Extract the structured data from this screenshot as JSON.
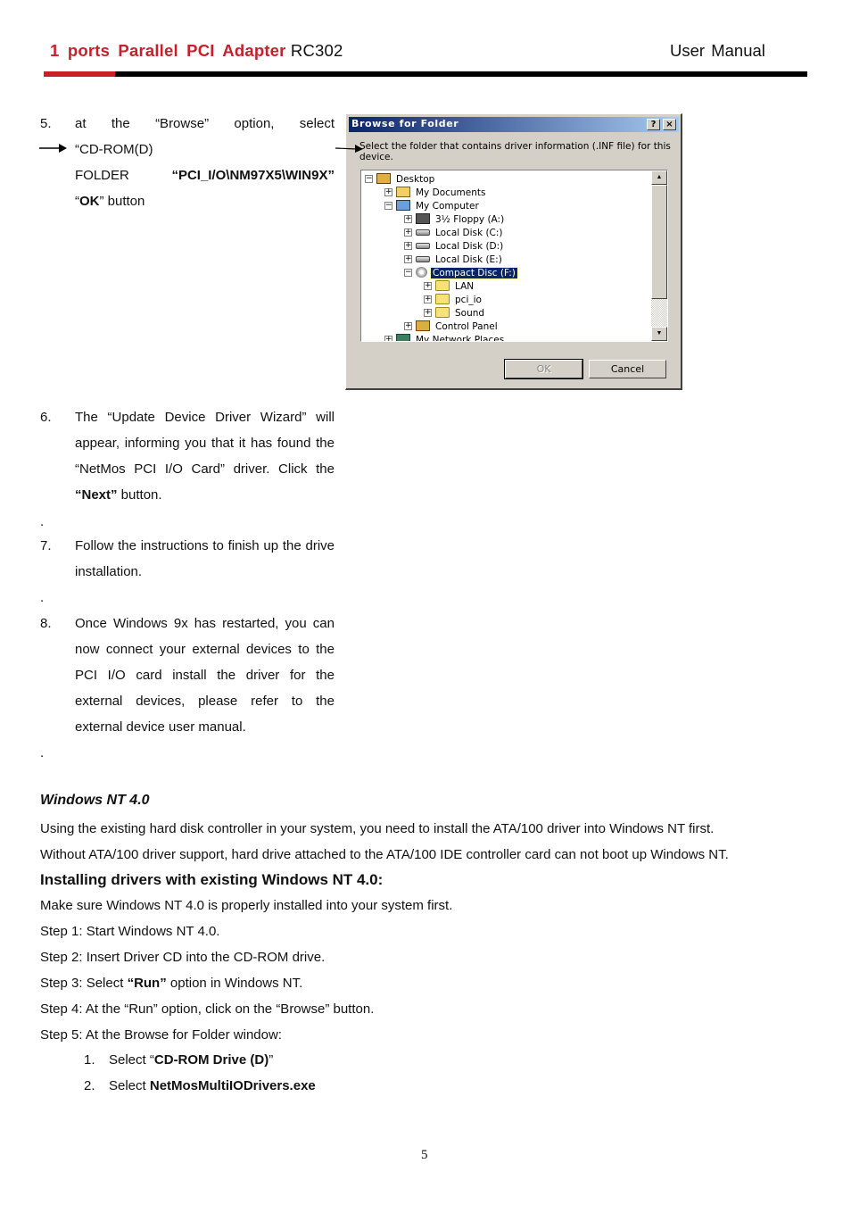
{
  "header": {
    "product": "1 ports Parallel PCI Adapter",
    "model": "RC302",
    "doc_type": "User Manual",
    "accent_color": "#c8202a"
  },
  "steps_9x": {
    "step5": {
      "number": "5.",
      "line1": "at the “Browse” option, select",
      "line2": "“CD-ROM(D)",
      "line3_prefix": "FOLDER",
      "line3_bold": "“PCI_I/O\\NM97X5\\WIN9X”",
      "line4_open": "“",
      "line4_bold": "OK",
      "line4_rest": "” button"
    },
    "step6": {
      "number": "6.",
      "text": "The “Update Device Driver Wizard” will appear, informing you that it has found the “NetMos PCI I/O Card” driver. Click the ",
      "bold": "“Next”",
      "tail": " button."
    },
    "step7": {
      "number": "7.",
      "text": "Follow the instructions to finish up the drive installation."
    },
    "step8": {
      "number": "8.",
      "text": "Once Windows 9x has restarted, you can now connect your external devices to the PCI I/O card install the driver for the external devices, please refer to the external device user manual."
    },
    "separator": "."
  },
  "dialog": {
    "title": "Browse for Folder",
    "help_button": "?",
    "close_button": "×",
    "message": "Select the folder that contains driver information (.INF file) for this device.",
    "tree": [
      {
        "label": "Desktop",
        "expander": "−",
        "icon": "desktop-icon"
      },
      {
        "label": "My Documents",
        "expander": "+",
        "icon": "my-documents-icon"
      },
      {
        "label": "My Computer",
        "expander": "−",
        "icon": "computer-icon"
      },
      {
        "label": "3½ Floppy (A:)",
        "expander": "+",
        "icon": "floppy-icon"
      },
      {
        "label": "Local Disk (C:)",
        "expander": "+",
        "icon": "hard-disk-icon"
      },
      {
        "label": "Local Disk (D:)",
        "expander": "+",
        "icon": "hard-disk-icon"
      },
      {
        "label": "Local Disk (E:)",
        "expander": "+",
        "icon": "hard-disk-icon"
      },
      {
        "label": "Compact Disc (F:)",
        "expander": "−",
        "icon": "cd-drive-icon",
        "selected": true
      },
      {
        "label": "LAN",
        "expander": "+",
        "icon": "folder-icon"
      },
      {
        "label": "pci_io",
        "expander": "+",
        "icon": "folder-icon"
      },
      {
        "label": "Sound",
        "expander": "+",
        "icon": "folder-icon"
      },
      {
        "label": "Control Panel",
        "expander": "+",
        "icon": "control-panel-icon"
      },
      {
        "label": "My Network Places",
        "expander": "+",
        "icon": "network-icon"
      }
    ],
    "ok_label": "OK",
    "cancel_label": "Cancel",
    "scroll_up": "▲",
    "scroll_down": "▼"
  },
  "nt": {
    "title": "Windows NT 4.0",
    "intro1": "Using the existing hard disk controller in your system, you need to install the ATA/100 driver into Windows NT first.",
    "intro2": "Without ATA/100 driver support, hard drive attached to the ATA/100 IDE controller card can not boot up Windows NT.",
    "heading": "Installing drivers with existing Windows NT 4.0:",
    "pre": "Make sure Windows NT 4.0 is properly installed into your system first.",
    "step1": "Step 1: Start Windows NT 4.0.",
    "step2": "Step 2: Insert Driver CD into the CD-ROM drive.",
    "step3_pre": "Step 3: Select ",
    "step3_bold": "“Run”",
    "step3_post": " option in Windows NT.",
    "step4": "Step 4: At the “Run” option, click on the “Browse” button.",
    "step5": "Step 5: At the Browse for Folder window:",
    "sub1_num": "1.",
    "sub1_pre": "Select “",
    "sub1_bold": "CD-ROM Drive (D)",
    "sub1_post": "”",
    "sub2_num": "2.",
    "sub2_pre": "Select ",
    "sub2_bold": "NetMosMultiIODrivers.exe"
  },
  "page_number": "5"
}
